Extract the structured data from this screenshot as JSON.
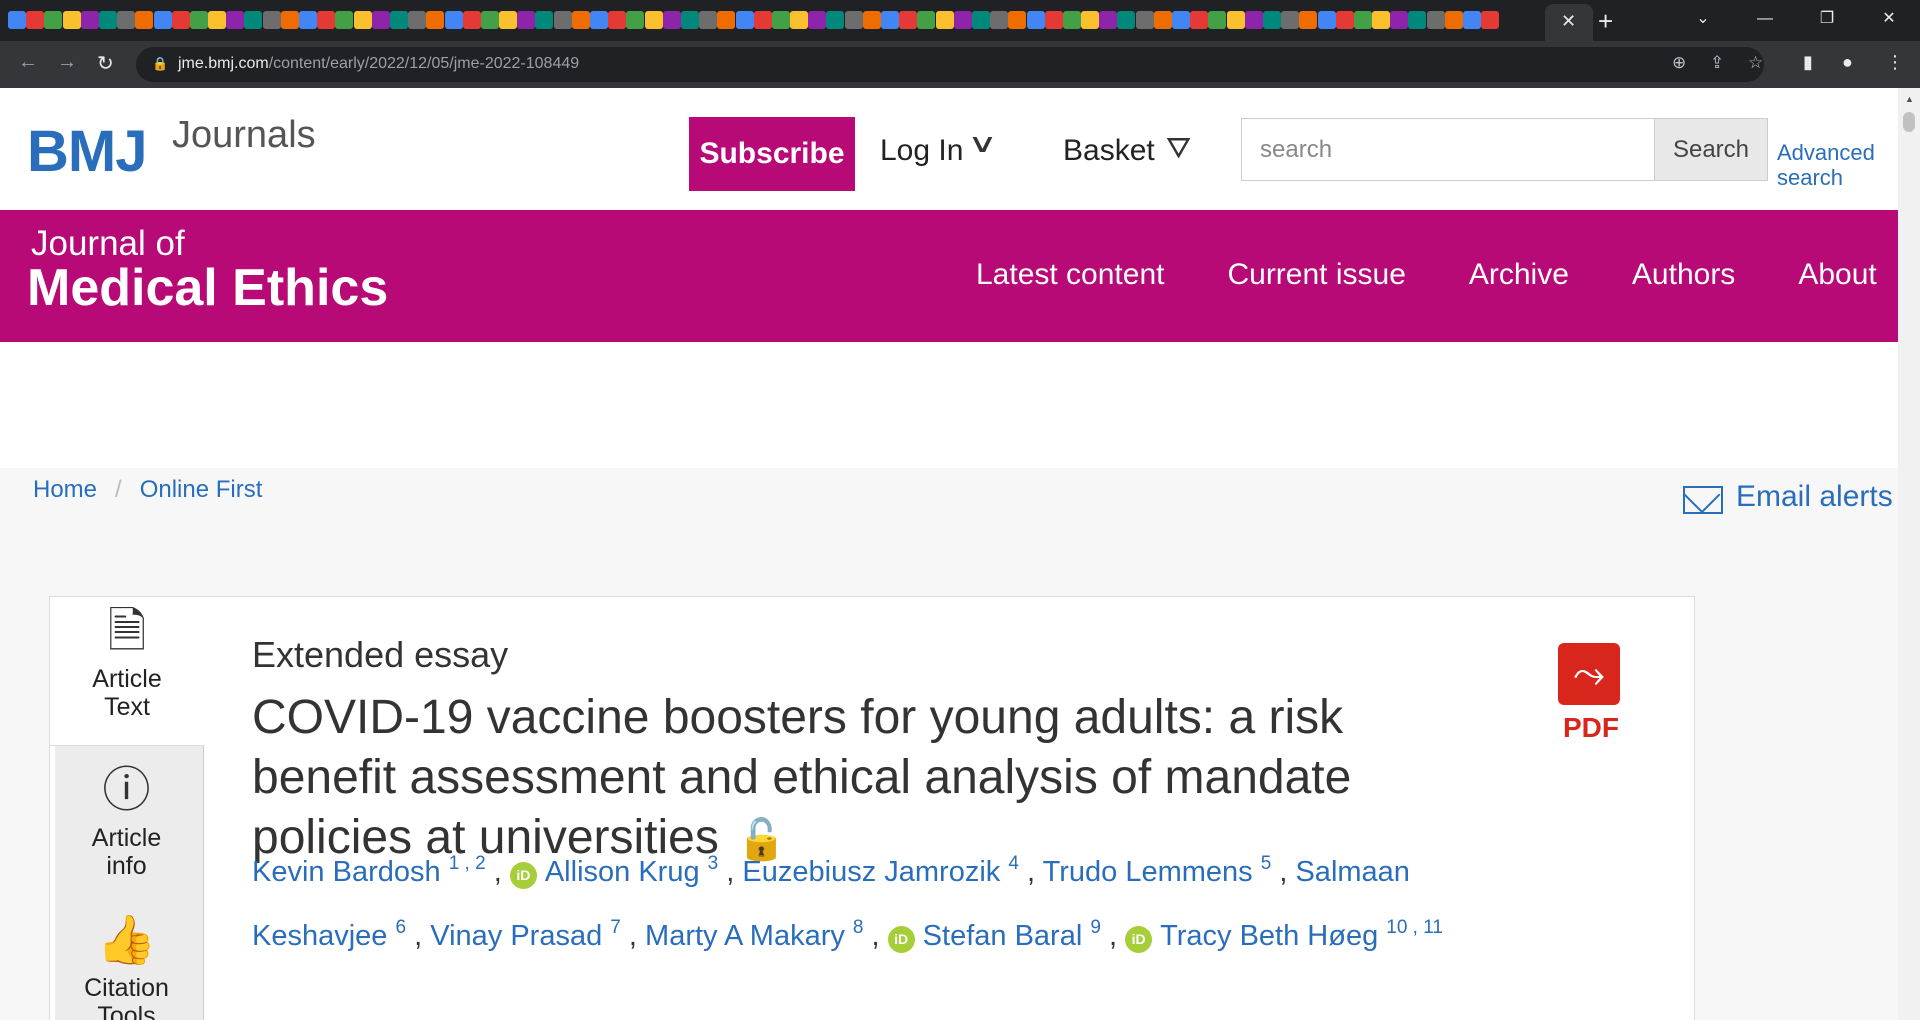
{
  "browser": {
    "url_domain": "jme.bmj.com",
    "url_path": "/content/early/2022/12/05/jme-2022-108449",
    "active_tab_close": "✕",
    "new_tab": "+",
    "window_controls": [
      "⌄",
      "—",
      "❐",
      "✕"
    ]
  },
  "site": {
    "logo_main": "BMJ",
    "logo_sub": "Journals",
    "subscribe_label": "Subscribe",
    "login_label": "Log In",
    "basket_label": "Basket",
    "search_placeholder": "search",
    "search_button": "Search",
    "advanced_search_line1": "Advanced",
    "advanced_search_line2": "search"
  },
  "journal": {
    "title_line1": "Journal of",
    "title_line2": "Medical Ethics",
    "nav": [
      "Latest content",
      "Current issue",
      "Archive",
      "Authors",
      "About"
    ]
  },
  "breadcrumb": {
    "home": "Home",
    "separator": "/",
    "current": "Online First"
  },
  "email_alerts": "Email alerts",
  "side_tabs": [
    {
      "line1": "Article",
      "line2": "Text"
    },
    {
      "line1": "Article",
      "line2": "info"
    },
    {
      "line1": "Citation",
      "line2": "Tools"
    }
  ],
  "article": {
    "type": "Extended essay",
    "title": "COVID-19 vaccine boosters for young adults: a risk benefit assessment and ethical analysis of mandate policies at universities",
    "authors": [
      {
        "name": "Kevin Bardosh",
        "sup": "1 , 2",
        "orcid": false
      },
      {
        "name": "Allison Krug",
        "sup": "3",
        "orcid": true
      },
      {
        "name": "Euzebiusz Jamrozik",
        "sup": "4",
        "orcid": false
      },
      {
        "name": "Trudo Lemmens",
        "sup": "5",
        "orcid": false
      },
      {
        "name": "Salmaan Keshavjee",
        "sup": "6",
        "orcid": false
      },
      {
        "name": "Vinay Prasad",
        "sup": "7",
        "orcid": false
      },
      {
        "name": "Marty A Makary",
        "sup": "8",
        "orcid": false
      },
      {
        "name": "Stefan Baral",
        "sup": "9",
        "orcid": true
      },
      {
        "name": "Tracy Beth Høeg",
        "sup": "10 , 11",
        "orcid": true
      }
    ],
    "pdf_label": "PDF"
  },
  "colors": {
    "brand_magenta": "#b70a77",
    "link_blue": "#2a6ebb",
    "pdf_red": "#d9261c",
    "orcid_green": "#a6ce39",
    "open_access_orange": "#e07b1a"
  }
}
